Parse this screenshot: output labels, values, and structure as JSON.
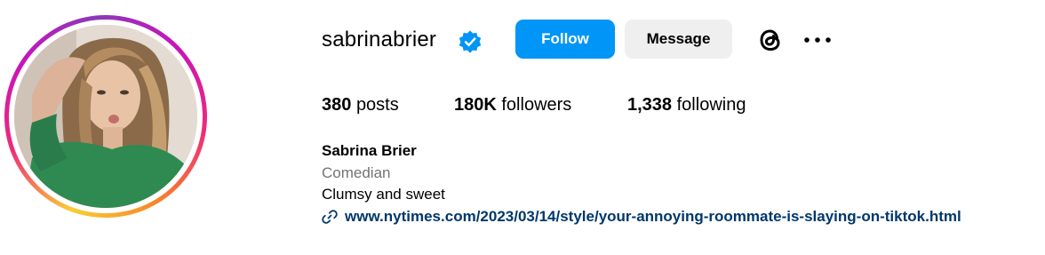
{
  "profile": {
    "username": "sabrinabrier",
    "full_name": "Sabrina Brier",
    "category": "Comedian",
    "bio": "Clumsy and sweet",
    "link": "www.nytimes.com/2023/03/14/style/your-annoying-roommate-is-slaying-on-tiktok.html",
    "verified_icon": "verified-badge-icon",
    "avatar_icon": "profile-photo"
  },
  "actions": {
    "follow_label": "Follow",
    "message_label": "Message",
    "threads_icon": "threads-icon",
    "more_icon": "more-options-icon"
  },
  "stats": {
    "posts_count": "380",
    "posts_label": "posts",
    "followers_count": "180K",
    "followers_label": "followers",
    "following_count": "1,338",
    "following_label": "following"
  },
  "colors": {
    "follow_button": "#0095f6",
    "message_button": "#efefef",
    "link_text": "#00376b",
    "category_text": "#737373",
    "verified_badge": "#0095f6"
  }
}
